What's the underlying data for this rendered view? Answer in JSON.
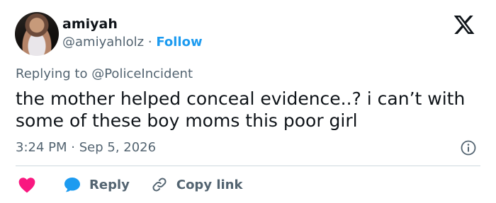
{
  "author": {
    "name": "amiyah",
    "handle": "@amiyahlolz",
    "separator": "·",
    "follow_label": "Follow"
  },
  "reply_context": {
    "prefix": "Replying to",
    "mention": "@PoliceIncident"
  },
  "tweet": {
    "text": "the mother helped conceal evidence..? i can’t with some of these boy moms this poor girl",
    "time": "3:24 PM",
    "separator": "·",
    "date": "Sep 5, 2026"
  },
  "actions": {
    "reply_label": "Reply",
    "copy_label": "Copy link"
  },
  "icons": {
    "logo": "x-logo-icon",
    "info": "info-icon",
    "like": "heart-icon",
    "reply": "reply-bubble-icon",
    "copy": "link-icon"
  },
  "colors": {
    "accent": "#1d9bf0",
    "heart": "#f91880",
    "text_primary": "#0f1419",
    "text_secondary": "#536471",
    "divider": "#cfd9de"
  }
}
